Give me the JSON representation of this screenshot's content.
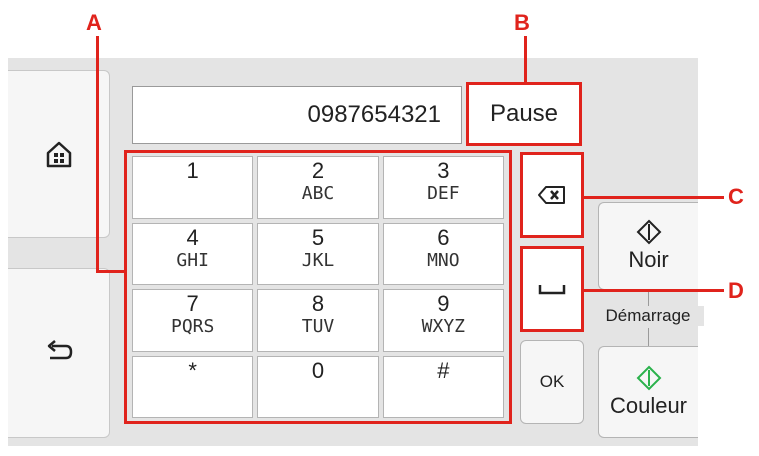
{
  "display": {
    "number": "0987654321"
  },
  "buttons": {
    "pause": "Pause",
    "ok": "OK",
    "start_black": "Noir",
    "start_color": "Couleur",
    "start_label": "Démarrage"
  },
  "keypad": [
    {
      "digit": "1",
      "letters": ""
    },
    {
      "digit": "2",
      "letters": "ABC"
    },
    {
      "digit": "3",
      "letters": "DEF"
    },
    {
      "digit": "4",
      "letters": "GHI"
    },
    {
      "digit": "5",
      "letters": "JKL"
    },
    {
      "digit": "6",
      "letters": "MNO"
    },
    {
      "digit": "7",
      "letters": "PQRS"
    },
    {
      "digit": "8",
      "letters": "TUV"
    },
    {
      "digit": "9",
      "letters": "WXYZ"
    },
    {
      "digit": "*",
      "letters": ""
    },
    {
      "digit": "0",
      "letters": ""
    },
    {
      "digit": "#",
      "letters": ""
    }
  ],
  "callouts": {
    "a": "A",
    "b": "B",
    "c": "C",
    "d": "D"
  },
  "icons": {
    "home": "home-icon",
    "back": "back-arrow-icon",
    "backspace": "backspace-icon",
    "space": "space-icon",
    "start": "diamond-start-icon"
  },
  "colors": {
    "callout": "#e0231c",
    "start_black": "#222222",
    "start_color": "#2bb24c"
  }
}
